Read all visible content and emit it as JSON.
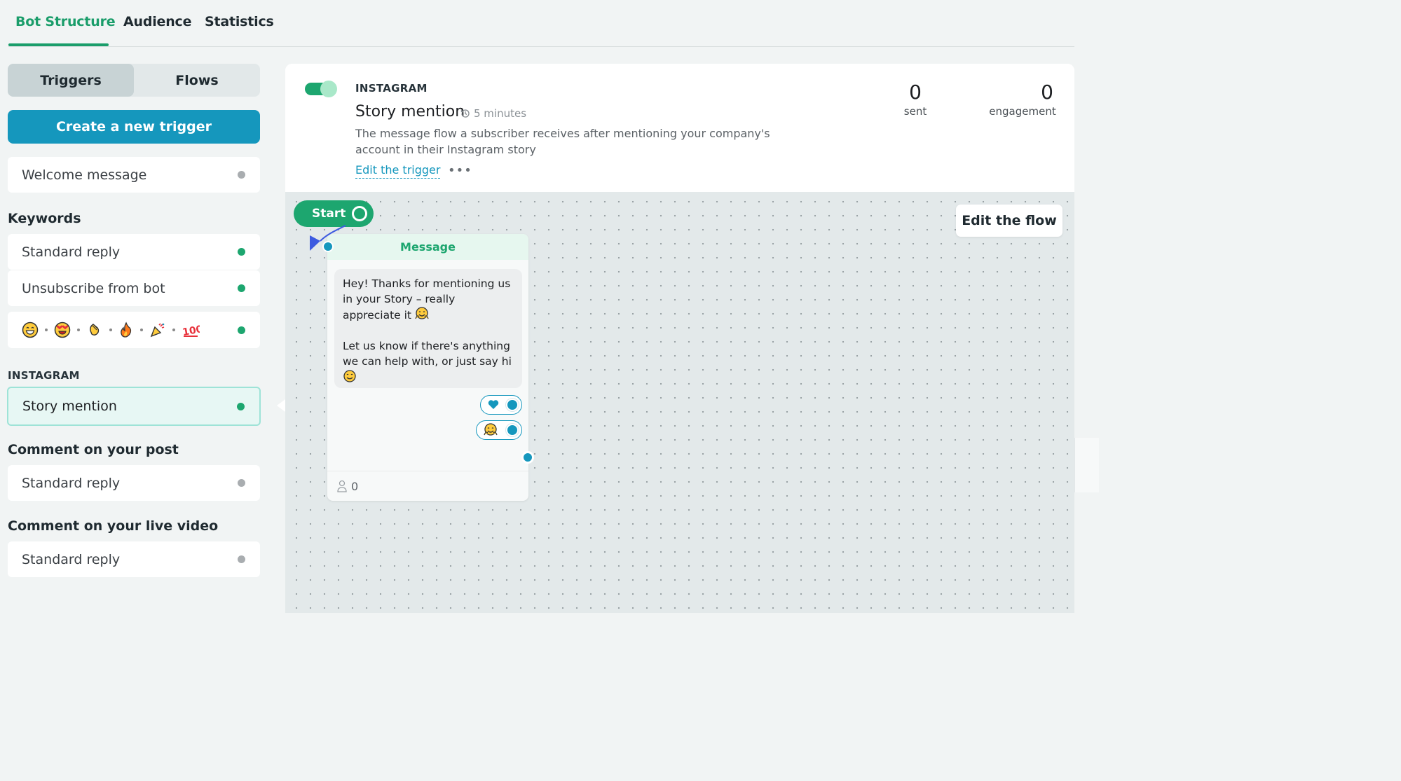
{
  "tabs": [
    {
      "label": "Bot Structure",
      "active": true
    },
    {
      "label": "Audience",
      "active": false
    },
    {
      "label": "Statistics",
      "active": false
    }
  ],
  "sidebar": {
    "segments": [
      {
        "label": "Triggers",
        "active": true
      },
      {
        "label": "Flows",
        "active": false
      }
    ],
    "create_button": "Create a new trigger",
    "welcome": {
      "label": "Welcome message",
      "status": "inactive"
    },
    "sections": {
      "keywords": "Keywords",
      "instagram": "INSTAGRAM",
      "comment_post": "Comment on your post",
      "comment_live": "Comment on your live video"
    },
    "keyword_items": [
      {
        "label": "Standard reply",
        "status": "active"
      },
      {
        "label": "Unsubscribe from bot",
        "status": "active"
      }
    ],
    "emoji_item": {
      "emojis": [
        "grinning-face",
        "heart-eyes",
        "clapping-hands",
        "fire",
        "party-popper",
        "hundred-points"
      ],
      "status": "active"
    },
    "instagram_items": [
      {
        "label": "Story mention",
        "status": "active",
        "selected": true
      }
    ],
    "comment_post_items": [
      {
        "label": "Standard reply",
        "status": "inactive"
      }
    ],
    "comment_live_items": [
      {
        "label": "Standard reply",
        "status": "inactive"
      }
    ]
  },
  "trigger": {
    "enabled": true,
    "platform": "INSTAGRAM",
    "title": "Story mention",
    "delay": "5 minutes",
    "description": "The message flow a subscriber receives after mentioning your company's account in their Instagram story",
    "edit_link": "Edit the trigger",
    "more": "•••",
    "stats": [
      {
        "value": "0",
        "label": "sent"
      },
      {
        "value": "0",
        "label": "engagement"
      }
    ]
  },
  "canvas": {
    "start_label": "Start",
    "edit_flow_label": "Edit the flow",
    "message": {
      "header": "Message",
      "paragraph1": "Hey! Thanks for mentioning us in your Story – really appreciate it",
      "paragraph1_emoji": "hugging-face-icon",
      "paragraph2": "Let us know if there's anything we can help with, or just say hi",
      "paragraph2_emoji": "smiling-face-icon",
      "quick_replies": [
        "heart-icon",
        "hugging-face-icon"
      ],
      "subscriber_count": "0"
    }
  },
  "colors": {
    "brand_green": "#1da66f",
    "brand_blue": "#1597bd",
    "inactive_dot": "#a9adb0"
  }
}
